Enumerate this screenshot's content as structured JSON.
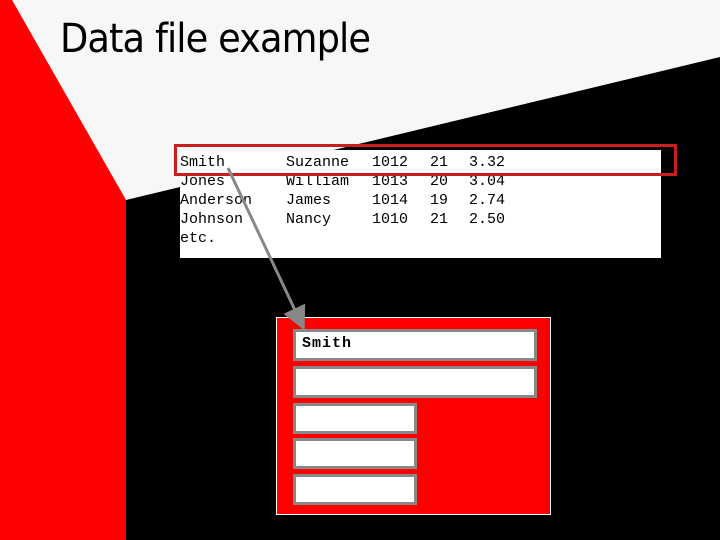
{
  "slide": {
    "title": "Data file example",
    "colors": {
      "background": "#f7f7f7",
      "accent_red": "#ff0000",
      "dark": "#000000",
      "highlight_border": "#c81e1e",
      "field_border": "#888888",
      "arrow": "#888888"
    }
  },
  "data_file": {
    "rows": [
      [
        "Smith",
        "Suzanne",
        "1012",
        "21",
        "3.32"
      ],
      [
        "Jones",
        "William",
        "1013",
        "20",
        "3.04"
      ],
      [
        "Anderson",
        "James",
        "1014",
        "19",
        "2.74"
      ],
      [
        "Johnson",
        "Nancy",
        "1010",
        "21",
        "2.50"
      ],
      [
        "etc.",
        "",
        "",
        "",
        ""
      ]
    ],
    "highlighted_row": 0
  },
  "record": {
    "fields": [
      "Smith",
      "",
      "",
      "",
      ""
    ]
  },
  "arrow": {
    "from": "data-file-row-0-last-name",
    "to": "record-field-0"
  }
}
